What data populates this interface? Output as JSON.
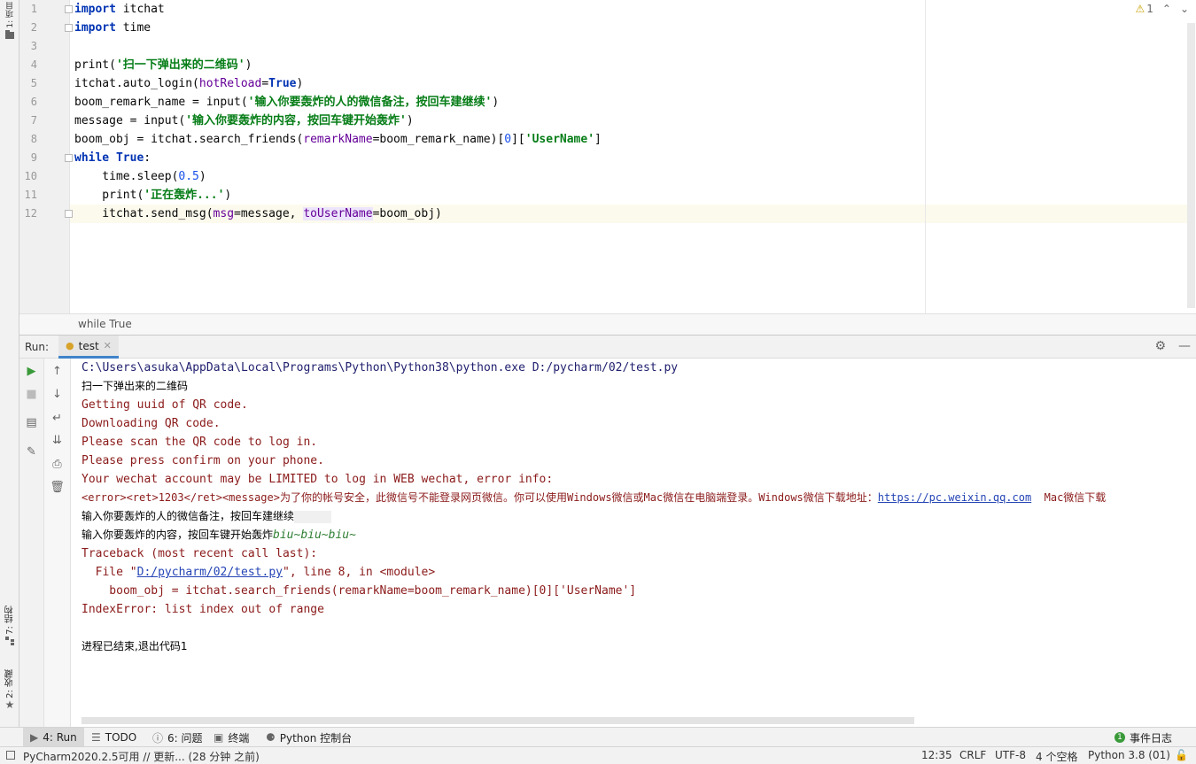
{
  "left_strip": {
    "project_tab": "1: 项目",
    "structure_tab": "7: 结构",
    "favorites_tab": "2: 收藏"
  },
  "editor": {
    "line_numbers": [
      "1",
      "2",
      "3",
      "4",
      "5",
      "6",
      "7",
      "8",
      "9",
      "10",
      "11",
      "12"
    ],
    "inspection_count": "1",
    "code": {
      "l1_kw": "import",
      "l1_rest": " itchat",
      "l2_kw": "import",
      "l2_rest": " time",
      "l4_a": "print(",
      "l4_str": "'扫一下弹出来的二维码'",
      "l4_b": ")",
      "l5_a": "itchat.auto_login(",
      "l5_param": "hotReload",
      "l5_eq": "=",
      "l5_kw": "True",
      "l5_b": ")",
      "l6_a": "boom_remark_name = input(",
      "l6_str": "'输入你要轰炸的人的微信备注，按回车建继续'",
      "l6_b": ")",
      "l7_a": "message = input(",
      "l7_str": "'输入你要轰炸的内容，按回车键开始轰炸'",
      "l7_b": ")",
      "l8_a": "boom_obj = itchat.search_friends(",
      "l8_param": "remarkName",
      "l8_b": "=boom_remark_name)[",
      "l8_num": "0",
      "l8_c": "][",
      "l8_str": "'UserName'",
      "l8_d": "]",
      "l9_kw": "while",
      "l9_sp": " ",
      "l9_kw2": "True",
      "l9_b": ":",
      "l10_a": "    time.sleep(",
      "l10_num": "0.5",
      "l10_b": ")",
      "l11_a": "    print(",
      "l11_str": "'正在轰炸...'",
      "l11_b": ")",
      "l12_a": "    itchat.send_msg(",
      "l12_p1": "msg",
      "l12_b": "=message, ",
      "l12_p2": "toUserName",
      "l12_c": "=boom_obj)"
    },
    "breadcrumb": "while True"
  },
  "run_panel": {
    "label": "Run:",
    "tab": "test",
    "console": {
      "cmd": "C:\\Users\\asuka\\AppData\\Local\\Programs\\Python\\Python38\\python.exe D:/pycharm/02/test.py",
      "out1": "扫一下弹出来的二维码",
      "err1": "Getting uuid of QR code.",
      "err2": "Downloading QR code.",
      "err3": "Please scan the QR code to log in.",
      "err4": "Please press confirm on your phone.",
      "err5": "Your wechat account may be LIMITED to log in WEB wechat, error info:",
      "err6_a": "<error><ret>1203</ret><message>为了你的帐号安全，此微信号不能登录网页微信。你可以使用Windows微信或Mac微信在电脑端登录。Windows微信下载地址：",
      "err6_link": "https://pc.weixin.qq.com",
      "err6_b": "  Mac微信下载",
      "prompt1": "输入你要轰炸的人的微信备注，按回车建继续",
      "prompt2": "输入你要轰炸的内容，按回车键开始轰炸",
      "prompt2_input": "biu~biu~biu~",
      "tb1": "Traceback (most recent call last):",
      "tb2_a": "  File \"",
      "tb2_link": "D:/pycharm/02/test.py",
      "tb2_b": "\", line 8, in <module>",
      "tb3": "    boom_obj = itchat.search_friends(remarkName=boom_remark_name)[0]['UserName']",
      "tb4": "IndexError: list index out of range",
      "exit": "进程已结束,退出代码1"
    }
  },
  "tool_windows": {
    "run": "4: Run",
    "todo": "TODO",
    "problems": "6: 问题",
    "terminal": "终端",
    "python_console": "Python 控制台",
    "event_log": "事件日志",
    "event_log_count": "1"
  },
  "status_bar": {
    "message": "PyCharm2020.2.5可用 // 更新... (28 分钟 之前)",
    "position": "12:35",
    "line_sep": "CRLF",
    "encoding": "UTF-8",
    "indent": "4 个空格",
    "interpreter": "Python 3.8 (01)"
  },
  "colors": {
    "keyword": "#0033b3",
    "string": "#067d17",
    "number": "#1750eb",
    "param": "#660099",
    "error_text": "#8b1a1a",
    "active_tab_underline": "#4083c9"
  }
}
